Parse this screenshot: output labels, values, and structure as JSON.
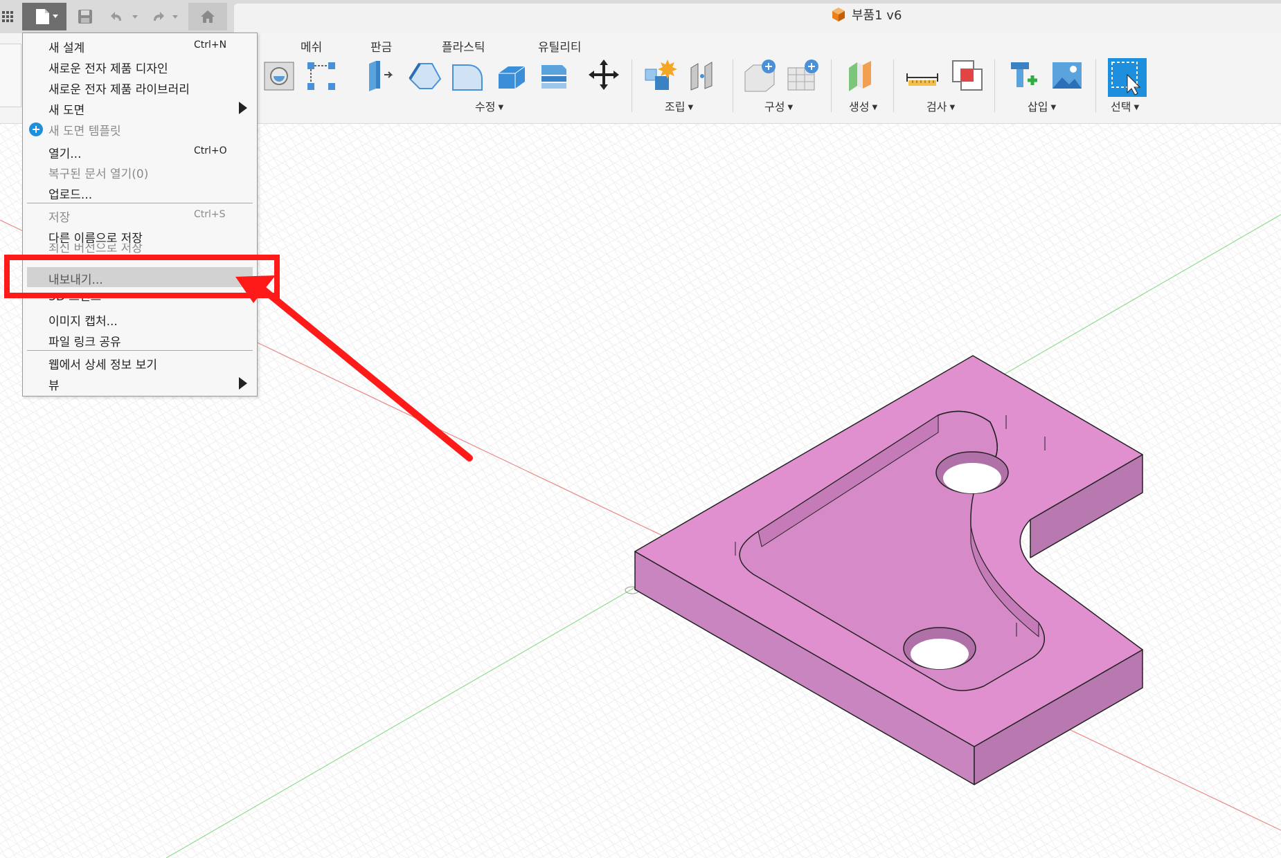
{
  "app": {
    "document_title": "부품1 v6"
  },
  "toolbar": {
    "tabs": [
      "메쉬",
      "판금",
      "플라스틱",
      "유틸리티"
    ],
    "groups": [
      "수정",
      "조립",
      "구성",
      "생성",
      "검사",
      "삽입",
      "선택"
    ]
  },
  "file_menu": {
    "items": [
      {
        "label": "새 설계",
        "shortcut": "Ctrl+N"
      },
      {
        "label": "새로운 전자 제품 디자인"
      },
      {
        "label": "새로운 전자 제품 라이브러리"
      },
      {
        "label": "새 도면"
      },
      {
        "label": "새 도면 템플릿"
      },
      {
        "label": "열기...",
        "shortcut": "Ctrl+O"
      },
      {
        "label": "복구된 문서 열기(0)"
      },
      {
        "label": "업로드..."
      },
      {
        "label": "저장",
        "shortcut": "Ctrl+S"
      },
      {
        "label": "다른 이름으로 저장"
      },
      {
        "label": "최신 버전으로 저장"
      },
      {
        "label": "내보내기..."
      },
      {
        "label": "3D 프린트"
      },
      {
        "label": "이미지 캡처..."
      },
      {
        "label": "파일 링크 공유"
      },
      {
        "label": "웹에서 상세 정보 보기"
      },
      {
        "label": "뷰"
      }
    ]
  },
  "colors": {
    "part_top": "#e08fcf",
    "part_side": "#c985c0",
    "highlight_red": "#ff1a1a",
    "x_axis": "#e88a8a",
    "y_axis": "#8fdc8f"
  },
  "icons": [
    "grid-apps-icon",
    "file-icon",
    "save-icon",
    "undo-icon",
    "redo-icon",
    "home-icon",
    "part-cube-icon",
    "arrow-pointer"
  ]
}
